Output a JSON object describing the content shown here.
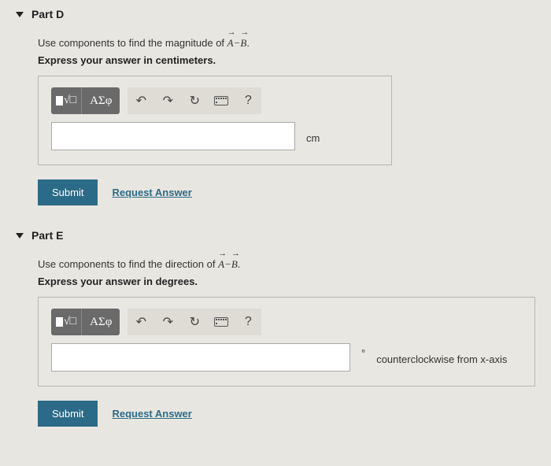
{
  "parts": {
    "d": {
      "title": "Part D",
      "prompt_prefix": "Use components to find the magnitude of ",
      "prompt_math_a": "A",
      "prompt_math_op": " − ",
      "prompt_math_b": "B",
      "prompt_suffix": ".",
      "instruction": "Express your answer in centimeters.",
      "unit": "cm",
      "submit": "Submit",
      "request": "Request Answer"
    },
    "e": {
      "title": "Part E",
      "prompt_prefix": "Use components to find the  direction of ",
      "prompt_math_a": "A",
      "prompt_math_op": " − ",
      "prompt_math_b": "B",
      "prompt_suffix": ".",
      "instruction": "Express your answer in degrees.",
      "unit_symbol": "°",
      "unit_text": "counterclockwise from x-axis",
      "submit": "Submit",
      "request": "Request Answer"
    }
  },
  "toolbar": {
    "greek": "ΑΣφ",
    "help": "?"
  }
}
